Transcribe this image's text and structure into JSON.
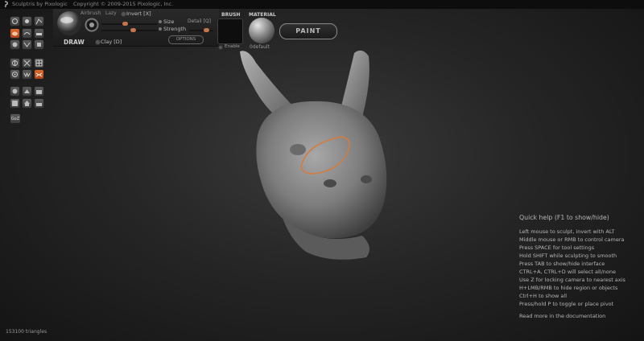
{
  "titlebar": {
    "app": "Sculptris by Pixologic",
    "copyright": "Copyright © 2009-2015 Pixologic, Inc."
  },
  "brush_panel": {
    "tool_name": "DRAW",
    "airbrush_label": "Airbrush",
    "lazy_label": "Lazy",
    "invert_label": "Invert [X]",
    "size_label": "Size",
    "strength_label": "Strength",
    "detail_label": "Detail [Q]",
    "clay_label": "Clay [D]",
    "options_label": "OPTIONS"
  },
  "brush": {
    "header": "BRUSH",
    "enable_label": "Enable"
  },
  "material": {
    "header": "MATERIAL",
    "name": "0default"
  },
  "paint_button": "PAINT",
  "quick_help": {
    "title": "Quick help (F1 to show/hide)",
    "lines": [
      "Left mouse to sculpt, invert with ALT",
      "Middle mouse or RMB to control camera",
      "Press SPACE for tool settings",
      "Hold SHIFT while sculpting to smooth",
      "Press TAB to show/hide interface",
      "CTRL+A, CTRL+D will select all/none",
      "Use Z for locking camera to nearest axis",
      "H+LMB/RMB to hide region or objects",
      "Ctrl+H to show all",
      "Press/hold P to toggle or place pivot"
    ],
    "more": "Read more in the documentation"
  },
  "status": {
    "triangles": "153100 triangles"
  },
  "toolbar_extra": {
    "goz_label": "GoZ"
  }
}
